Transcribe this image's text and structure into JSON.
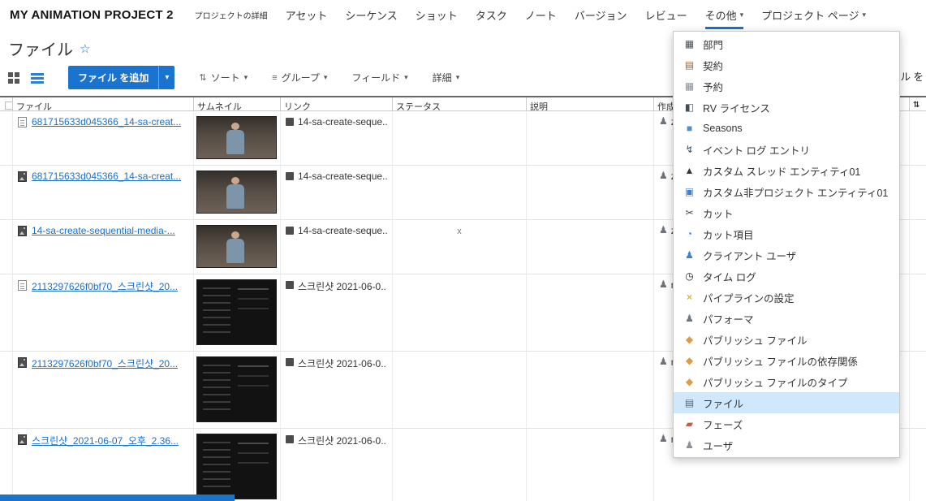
{
  "colors": {
    "accent": "#1a73cf",
    "link": "#1b6fc7",
    "menu_selected_bg": "#cfe8fb"
  },
  "nav": {
    "project_title": "MY ANIMATION PROJECT 2",
    "items": [
      {
        "label": "プロジェクトの詳細",
        "small": true
      },
      {
        "label": "アセット"
      },
      {
        "label": "シーケンス"
      },
      {
        "label": "ショット"
      },
      {
        "label": "タスク"
      },
      {
        "label": "ノート"
      },
      {
        "label": "バージョン"
      },
      {
        "label": "レビュー"
      },
      {
        "label": "その他",
        "caret": true,
        "active": true
      },
      {
        "label": "プロジェクト ページ",
        "caret": true
      }
    ]
  },
  "page": {
    "title": "ファイル",
    "star": "☆"
  },
  "toolbar": {
    "add_button": "ファイル を追加",
    "sort": "ソート",
    "group": "グループ",
    "fields": "フィールド",
    "details": "詳細"
  },
  "filter_fragment": "ル を",
  "table": {
    "columns": [
      "ファイル",
      "サムネイル",
      "リンク",
      "ステータス",
      "説明",
      "作成"
    ],
    "rows": [
      {
        "type": "file",
        "name": "681715633d045366_14-sa-creat...",
        "thumb": "photo",
        "link": "14-sa-create-seque...",
        "status": "",
        "description": "",
        "created_by": "z"
      },
      {
        "type": "image",
        "name": "681715633d045366_14-sa-creat...",
        "thumb": "photo",
        "link": "14-sa-create-seque...",
        "status": "",
        "description": "",
        "created_by": "z"
      },
      {
        "type": "image",
        "name": "14-sa-create-sequential-media-...",
        "thumb": "photo",
        "link": "14-sa-create-seque...",
        "status": "x",
        "description": "",
        "created_by": "z"
      },
      {
        "type": "file",
        "name": "2113297626f0bf70_스크린샷_20...",
        "thumb": "screenshot",
        "link": "스크린샷 2021-06-0...",
        "status": "",
        "description": "",
        "created_by": "n"
      },
      {
        "type": "image",
        "name": "2113297626f0bf70_스크린샷_20...",
        "thumb": "screenshot",
        "link": "스크린샷 2021-06-0...",
        "status": "",
        "description": "",
        "created_by": "n"
      },
      {
        "type": "image",
        "name": "스크린샷_2021-06-07_오후_2.36...",
        "thumb": "screenshot",
        "link": "스크린샷 2021-06-0...",
        "status": "",
        "description": "",
        "created_by": "n"
      }
    ]
  },
  "entity_menu": {
    "items": [
      {
        "id": "department",
        "label": "部門",
        "icon": "department"
      },
      {
        "id": "contract",
        "label": "契約",
        "icon": "contract"
      },
      {
        "id": "booking",
        "label": "予約",
        "icon": "booking"
      },
      {
        "id": "rv-license",
        "label": "RV ライセンス",
        "icon": "rv-license"
      },
      {
        "id": "seasons",
        "label": "Seasons",
        "icon": "season"
      },
      {
        "id": "event-log",
        "label": "イベント ログ エントリ",
        "icon": "event-log"
      },
      {
        "id": "custom-entity",
        "label": "カスタム スレッド エンティティ01",
        "icon": "custom-entity"
      },
      {
        "id": "custom-nonproject-entity",
        "label": "カスタム非プロジェクト エンティティ01",
        "icon": "custom-nonproject-entity"
      },
      {
        "id": "cut",
        "label": "カット",
        "icon": "cut"
      },
      {
        "id": "cut-item",
        "label": "カット項目",
        "icon": "cut-item"
      },
      {
        "id": "client-user",
        "label": "クライアント ユーザ",
        "icon": "client-user"
      },
      {
        "id": "time-log",
        "label": "タイム ログ",
        "icon": "time-log"
      },
      {
        "id": "pipeline-config",
        "label": "パイプラインの設定",
        "icon": "pipeline-config"
      },
      {
        "id": "performer",
        "label": "パフォーマ",
        "icon": "performer"
      },
      {
        "id": "published-file",
        "label": "パブリッシュ ファイル",
        "icon": "published-file"
      },
      {
        "id": "published-file-dependency",
        "label": "パブリッシュ ファイルの依存関係",
        "icon": "published-file-dependency"
      },
      {
        "id": "published-file-type",
        "label": "パブリッシュ ファイルのタイプ",
        "icon": "published-file-type"
      },
      {
        "id": "file",
        "label": "ファイル",
        "icon": "file",
        "selected": true
      },
      {
        "id": "phase",
        "label": "フェーズ",
        "icon": "phase"
      },
      {
        "id": "user",
        "label": "ユーザ",
        "icon": "user"
      }
    ]
  }
}
